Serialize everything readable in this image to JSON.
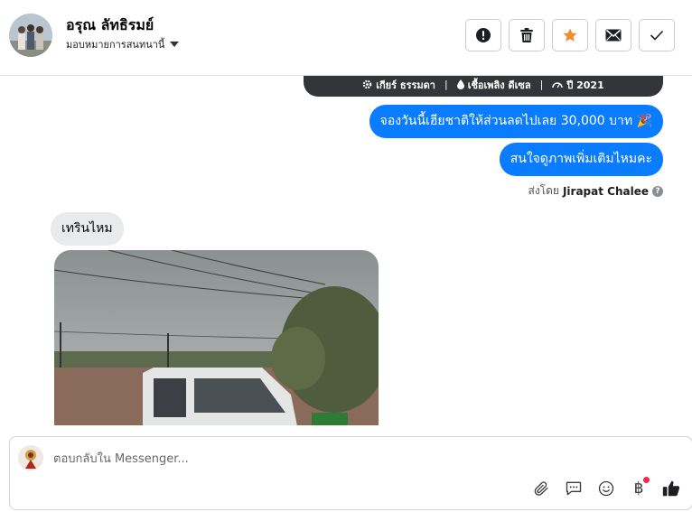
{
  "header": {
    "contact_name": "อรุณ ลัทธิรมย์",
    "assignee": "มอบหมายการสนทนานี้",
    "avatar_icon": "group-photo-avatar",
    "actions": [
      {
        "name": "report-button",
        "icon": "exclamation-circle-icon"
      },
      {
        "name": "delete-button",
        "icon": "trash-icon"
      },
      {
        "name": "star-button",
        "icon": "star-icon",
        "color": "#f28d2b"
      },
      {
        "name": "mark-unread-button",
        "icon": "envelope-icon"
      },
      {
        "name": "mark-done-button",
        "icon": "check-icon"
      }
    ]
  },
  "specs": {
    "gear": "เกียร์ ธรรมดา",
    "fuel": "เชื้อเพลิง ดีเซล",
    "year": "ปี 2021",
    "separator": "|"
  },
  "messages": {
    "outgoing_1": "จองวันนี้เฮียชาติให้ส่วนลดไปเลย 30,000 บาท 🎉",
    "outgoing_2": "สนใจดูภาพเพิ่มเติมไหมคะ",
    "sent_by_prefix": "ส่งโดย",
    "sent_by_name": "Jirapat Chalee",
    "help_glyph": "?",
    "incoming_1": "เทรินไหม"
  },
  "composer": {
    "placeholder": "ตอบกลับใน Messenger...",
    "baht_symbol": "฿",
    "tools": [
      "paperclip-icon",
      "chat-bubble-icon",
      "smiley-icon",
      "baht-icon",
      "thumbs-up-icon"
    ]
  },
  "colors": {
    "accent": "#0a7cff",
    "incoming_bubble": "#e9eaec",
    "spec_bar": "#333538",
    "star": "#f28d2b"
  }
}
